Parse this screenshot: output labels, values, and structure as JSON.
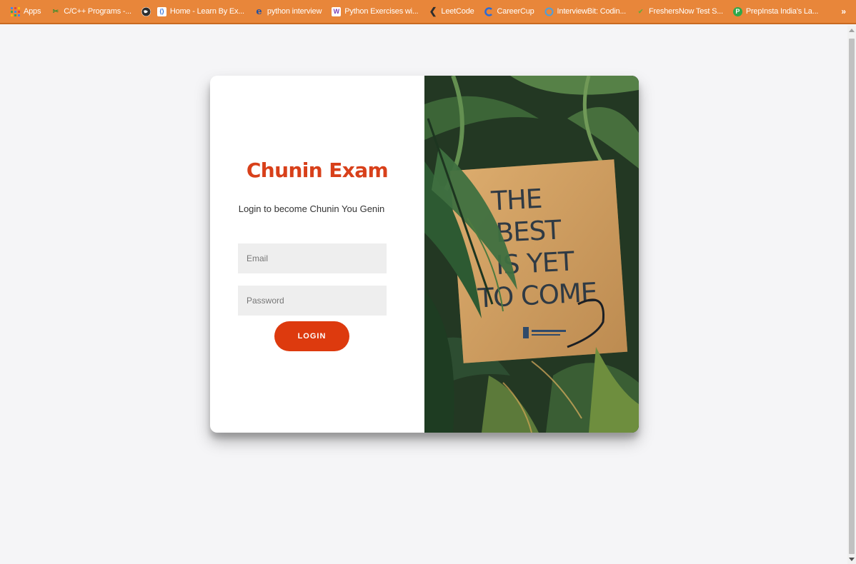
{
  "bookmarks": [
    {
      "label": "Apps",
      "icon": "apps-grid-icon",
      "color": "#e8863a"
    },
    {
      "label": "C/C++ Programs -...",
      "icon": "cpp-programs-icon",
      "color": "#3a8d2e"
    },
    {
      "label": "",
      "icon": "globe-icon",
      "color": "#2d2d2d"
    },
    {
      "label": "Home - Learn By Ex...",
      "icon": "learn-by-example-icon",
      "color": "#2a6bd6"
    },
    {
      "label": "python interview",
      "icon": "edureka-icon",
      "color": "#1e4fa3"
    },
    {
      "label": "Python Exercises wi...",
      "icon": "w3resource-icon",
      "color": "#7a3fb5"
    },
    {
      "label": "LeetCode",
      "icon": "leetcode-icon",
      "color": "#2d2d2d"
    },
    {
      "label": "CareerCup",
      "icon": "careercup-icon",
      "color": "#2a6bd6"
    },
    {
      "label": "InterviewBit: Codin...",
      "icon": "interviewbit-icon",
      "color": "#4a9fe0"
    },
    {
      "label": "FreshersNow Test S...",
      "icon": "freshersnow-icon",
      "color": "#6aa83a"
    },
    {
      "label": "PrepInsta India's La...",
      "icon": "prepinsta-icon",
      "color": "#2fa84a"
    }
  ],
  "bookmarks_more": "»",
  "login": {
    "title": "Chunin Exam",
    "subtitle": "Login to become Chunin You Genin",
    "email_placeholder": "Email",
    "password_placeholder": "Password",
    "button_label": "LOGIN"
  },
  "image": {
    "sign_lines": [
      "THE",
      "BEST",
      "IS YET",
      "TO COME"
    ]
  },
  "colors": {
    "bookmark_bar": "#e8863a",
    "title": "#d8401a",
    "button": "#dd3a0e",
    "page_bg": "#f5f5f7"
  }
}
